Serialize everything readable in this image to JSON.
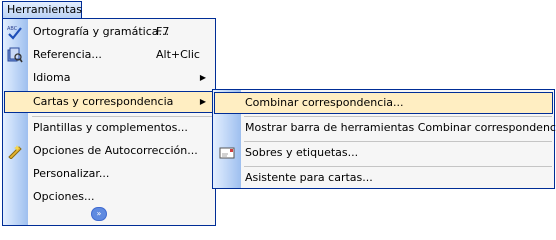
{
  "menubar": {
    "title": "Herramientas"
  },
  "menu": {
    "items": [
      {
        "label": "Ortografía y gramática...",
        "shortcut": "F7",
        "icon": "spellcheck-icon"
      },
      {
        "label": "Referencia...",
        "shortcut": "Alt+Clic",
        "icon": "research-icon"
      },
      {
        "label": "Idioma",
        "submenu": true
      },
      {
        "label": "Cartas y correspondencia",
        "submenu": true,
        "highlighted": true
      },
      {
        "label": "Plantillas y complementos..."
      },
      {
        "label": "Opciones de Autocorrección...",
        "icon": "autocorrect-icon"
      },
      {
        "label": "Personalizar..."
      },
      {
        "label": "Opciones..."
      }
    ],
    "expand_icon": "chevron-double-down-icon"
  },
  "submenu": {
    "items": [
      {
        "label": "Combinar correspondencia...",
        "highlighted": true
      },
      {
        "label": "Mostrar barra de herramientas Combinar correspondencia"
      },
      {
        "label": "Sobres y etiquetas...",
        "icon": "envelope-icon"
      },
      {
        "label": "Asistente para cartas..."
      }
    ]
  },
  "colors": {
    "border": "#002d96",
    "highlight": "#ffeec2",
    "menu_bg": "#f6f6f6",
    "gutter_start": "#e3efff",
    "gutter_end": "#9ebfef"
  }
}
